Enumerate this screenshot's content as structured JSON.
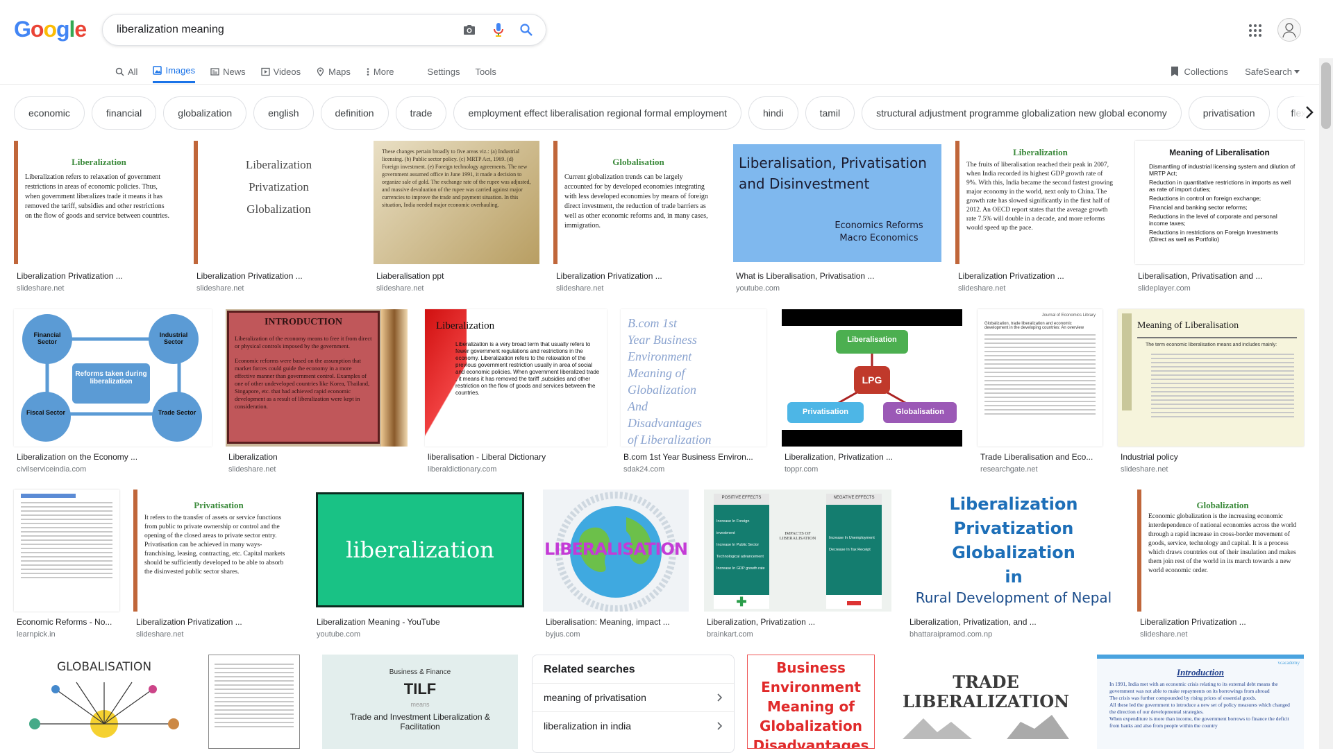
{
  "logo": [
    "G",
    "o",
    "o",
    "g",
    "l",
    "e"
  ],
  "search": {
    "query": "liberalization meaning"
  },
  "tabs": [
    {
      "label": "All",
      "icon": "search-icon"
    },
    {
      "label": "Images",
      "icon": "image-icon",
      "active": true
    },
    {
      "label": "News",
      "icon": "news-icon"
    },
    {
      "label": "Videos",
      "icon": "video-icon"
    },
    {
      "label": "Maps",
      "icon": "map-pin-icon"
    },
    {
      "label": "More",
      "icon": "more-dots-icon"
    }
  ],
  "tools": {
    "settings": "Settings",
    "tools": "Tools"
  },
  "right_tools": {
    "collections": "Collections",
    "safesearch": "SafeSearch"
  },
  "chips": [
    "economic",
    "financial",
    "globalization",
    "english",
    "definition",
    "trade",
    "employment effect liberalisation regional formal employment",
    "hindi",
    "tamil",
    "structural adjustment programme globalization new global economy",
    "privatisation",
    "flexi"
  ],
  "results": [
    {
      "caption": "Liberalization Privatization ...",
      "source": "slideshare.net",
      "thumb": {
        "heading": "Liberalization",
        "text": "Liberalization refers to relaxation of government restrictions in areas of economic policies. Thus, when government liberalizes trade it means it has removed the tariff, subsidies and other restrictions on the flow of goods and service between countries."
      }
    },
    {
      "caption": "Liberalization Privatization ...",
      "source": "slideshare.net",
      "thumb": {
        "lines": [
          "Liberalization",
          "Privatization",
          "Globalization"
        ]
      }
    },
    {
      "caption": "Liaberalisation ppt",
      "source": "slideshare.net",
      "thumb": {
        "text": "These changes pertain broadly to five areas viz.: (a) Industrial licensing. (b) Public sector policy. (c) MRTP Act, 1969. (d) Foreign investment. (e) Foreign technology agreements. The new government assumed office in June 1991, it made a decision to organize sale of gold. The exchange rate of the rupee was adjusted, and massive devaluation of the rupee was carried against major currencies to improve the trade and payment situation. In this situation, India needed major economic overhauling."
      }
    },
    {
      "caption": "Liberalization Privatization ...",
      "source": "slideshare.net",
      "thumb": {
        "heading": "Globalisation",
        "text": "Current globalization trends can be largely accounted for by developed economies integrating with less developed economies by means of foreign direct investment, the reduction of trade barriers as well as other economic reforms and, in many cases, immigration."
      }
    },
    {
      "caption": "What is Liberalisation, Privatisation ...",
      "source": "youtube.com",
      "thumb": {
        "title": "Liberalisation, Privatisation and Disinvestment",
        "sub1": "Economics Reforms",
        "sub2": "Macro Economics"
      }
    },
    {
      "caption": "Liberalization Privatization ...",
      "source": "slideshare.net",
      "thumb": {
        "heading": "Liberalization",
        "text": "The fruits of liberalisation reached their peak in 2007, when India recorded its highest GDP growth rate of 9%. With this, India became the second fastest growing major economy in the world, next only to China. The growth rate has slowed significantly in the first half of 2012. An OECD report states that the average growth rate 7.5% will double in a decade, and more reforms would speed up the pace."
      }
    },
    {
      "caption": "Liberalisation, Privatisation and ...",
      "source": "slideplayer.com",
      "thumb": {
        "heading": "Meaning of Liberalisation",
        "items": [
          "Dismantling of industrial licensing system and dilution of MRTP Act;",
          "Reduction in quantitative restrictions in imports as well as rate of import duties;",
          "Reductions in control on foreign exchange;",
          "Financial and banking sector reforms;",
          "Reductions in the level of corporate and personal income taxes;",
          "Reductions in restrictions on Foreign Investments (Direct as well as Portfolio)"
        ]
      }
    },
    {
      "caption": "Liberalization on the Economy ...",
      "source": "civilserviceindia.com",
      "thumb": {
        "center": "Reforms taken during liberalization",
        "nodes": [
          "Financial Sector",
          "Industrial Sector",
          "Fiscal Sector",
          "Trade Sector"
        ]
      }
    },
    {
      "caption": "Liberalization",
      "source": "slideshare.net",
      "thumb": {
        "heading": "INTRODUCTION",
        "text1": "Liberalization of the economy means to free it from direct or physical controls imposed by the government.",
        "text2": "Economic reforms were based on the assumption that market forces could guide the economy in a more effective manner than government control. Examples of one of other undeveloped countries like Korea, Thailand, Singapore, etc. that had achieved rapid economic development as a result of liberalization were kept in consideration."
      }
    },
    {
      "caption": "liberalisation - Liberal Dictionary",
      "source": "liberaldictionary.com",
      "thumb": {
        "heading": "Liberalization",
        "text": "Liberalization is a very broad term that usually refers to fewer government regulations and restrictions in the economy. Liberalization refers to the relaxation of the previous government restriction usually in area of social and economic policies. When government liberalized trade , it means it has removed the tariff ,subsidies and other restriction on the flow of goods and services between the countries."
      }
    },
    {
      "caption": "B.com 1st Year Business Environ...",
      "source": "sdak24.com",
      "thumb": {
        "lines": [
          "B.com 1st",
          "Year Business",
          "Environment",
          "Meaning of",
          "Globalization",
          "And",
          "Disadvantages",
          "of Liberalization"
        ]
      }
    },
    {
      "caption": "Liberalization, Privatization ...",
      "source": "toppr.com",
      "thumb": {
        "top": "Liberalisation",
        "center": "LPG",
        "left": "Privatisation",
        "right": "Globalisation"
      }
    },
    {
      "caption": "Trade Liberalisation and Eco...",
      "source": "researchgate.net",
      "thumb": {
        "header": "Journal of Economics Library",
        "title": "Globalization, trade liberalization and economic development in the developing countries: An overview"
      }
    },
    {
      "caption": "Industrial policy",
      "source": "slideshare.net",
      "thumb": {
        "heading": "Meaning of Liberalisation",
        "intro": "The term economic liberalisation means and includes mainly:"
      }
    },
    {
      "caption": "Economic Reforms - No...",
      "source": "learnpick.in",
      "thumb": {}
    },
    {
      "caption": "Liberalization Privatization ...",
      "source": "slideshare.net",
      "thumb": {
        "heading": "Privatisation",
        "text": "It refers to the transfer of assets or service functions from public to private ownership or control and the opening of the closed areas to private sector entry. Privatisation can be achieved in many ways- franchising, leasing, contracting, etc. Capital markets should be sufficiently developed to be able to absorb the disinvested public sector shares."
      }
    },
    {
      "caption": "Liberalization Meaning - YouTube",
      "source": "youtube.com",
      "thumb": {
        "word": "liberalization"
      }
    },
    {
      "caption": "Liberalisation: Meaning, impact ...",
      "source": "byjus.com",
      "thumb": {
        "word": "LIBERALISATION"
      }
    },
    {
      "caption": "Liberalization, Privatization ...",
      "source": "brainkart.com",
      "thumb": {
        "left_title": "POSITIVE EFFECTS",
        "right_title": "NEGATIVE EFFECTS",
        "center": "IMPACTS OF LIBERALISATION",
        "left_items": [
          "Increase In Foreign investment",
          "Increase In Public Sector",
          "Technological advancement",
          "Increase In GDP growth rate"
        ],
        "right_items": [
          "Increase In Unemployment",
          "Decrease In Tax Receipt"
        ]
      }
    },
    {
      "caption": "Liberalization, Privatization, and ...",
      "source": "bhattaraipramod.com.np",
      "thumb": {
        "lines": [
          "Liberalization",
          "Privatization",
          "Globalization",
          "in"
        ],
        "last": "Rural Development of Nepal"
      }
    },
    {
      "caption": "Liberalization Privatization ...",
      "source": "slideshare.net",
      "thumb": {
        "heading": "Globalization",
        "text": "Economic globalization is the increasing economic interdependence of national economies across the world through a rapid increase in cross-border movement of goods, service, technology and capital. It is a process which draws countries out of their insulation and makes them join rest of the world in its march towards a new world economic order."
      }
    },
    {
      "thumb": {
        "heading": "GLOBALISATION"
      }
    },
    {
      "thumb": {}
    },
    {
      "thumb": {
        "small": "Business & Finance",
        "word": "TILF",
        "means": "means",
        "sub": "Trade and Investment Liberalization & Facilitation"
      }
    },
    {
      "thumb": {
        "lines": [
          "Business",
          "Environment",
          "Meaning of",
          "Globalization",
          "Disadvantages"
        ]
      }
    },
    {
      "thumb": {
        "lines": [
          "TRADE",
          "LIBERALIZATION"
        ]
      }
    },
    {
      "thumb": {
        "heading": "Introduction",
        "brand": "vcacademy",
        "items": [
          "In 1991, India met with an economic crisis relating to its external debt means the government was not able to make repayments on its borrowings from abroad",
          "The crisis was further compounded by rising prices of essential goods.",
          "All these led the government to introduce a new set of policy measures which changed the direction of our developmental strategies.",
          "When expenditure is more than income, the government borrows to finance the deficit from banks and also from people within the country"
        ]
      }
    }
  ],
  "related": {
    "title": "Related searches",
    "items": [
      "meaning of privatisation",
      "liberalization in india"
    ]
  },
  "colors": {
    "accent": "#1a73e8",
    "google_blue": "#4285F4",
    "google_red": "#EA4335",
    "google_yellow": "#FBBC05",
    "google_green": "#34A853"
  }
}
